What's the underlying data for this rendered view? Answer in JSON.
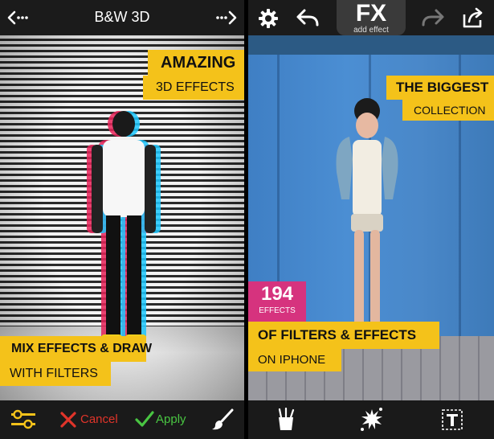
{
  "left": {
    "header": {
      "title": "B&W 3D"
    },
    "promo": {
      "headline": "AMAZING",
      "subline": "3D EFFECTS",
      "bottom_headline": "MIX EFFECTS & DRAW",
      "bottom_subline": "WITH FILTERS"
    },
    "bottombar": {
      "cancel_label": "Cancel",
      "apply_label": "Apply",
      "icons": [
        "sliders-icon",
        "cancel-x-icon",
        "apply-check-icon",
        "brush-icon"
      ]
    }
  },
  "right": {
    "header": {
      "fx_label": "FX",
      "fx_sublabel": "add effect",
      "icons": [
        "settings-gear-icon",
        "undo-icon",
        "redo-icon",
        "share-icon"
      ]
    },
    "promo": {
      "headline": "THE BIGGEST",
      "subline": "COLLECTION",
      "count": "194",
      "count_label": "EFFECTS",
      "filters_headline": "OF FILTERS & EFFECTS",
      "filters_subline": "ON IPHONE"
    },
    "bottombar": {
      "icons": [
        "tools-cup-icon",
        "splash-icon",
        "text-tool-icon"
      ]
    }
  },
  "colors": {
    "accent_yellow": "#f4c21a",
    "badge_pink": "#d6337e",
    "cancel_red": "#e0342a",
    "apply_green": "#49c542"
  }
}
